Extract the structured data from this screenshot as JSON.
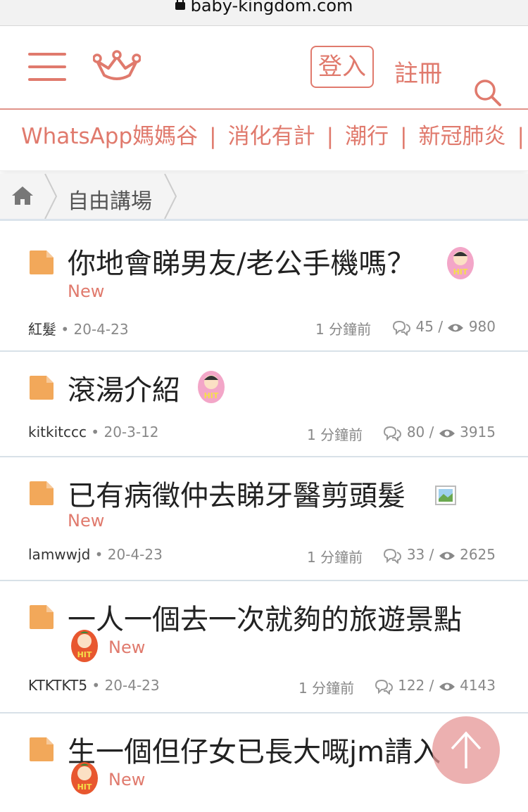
{
  "browser": {
    "url": "baby-kingdom.com"
  },
  "header": {
    "login_label": "登入",
    "register_label": "註冊"
  },
  "categories": [
    "WhatsApp媽媽谷",
    "消化有計",
    "潮行",
    "新冠肺炎"
  ],
  "breadcrumb": {
    "label": "自由講場"
  },
  "threads": [
    {
      "title": "你地會睇男友/老公手機嗎？",
      "new_label": "New",
      "author": "紅髮",
      "date": "20-4-23",
      "time_ago": "1 分鐘前",
      "replies": "45",
      "views": "980"
    },
    {
      "title": "滾湯介紹",
      "new_label": "",
      "author": "kitkitccc",
      "date": "20-3-12",
      "time_ago": "1 分鐘前",
      "replies": "80",
      "views": "3915"
    },
    {
      "title": "已有病徵仲去睇牙醫剪頭髮",
      "new_label": "New",
      "author": "lamwwjd",
      "date": "20-4-23",
      "time_ago": "1 分鐘前",
      "replies": "33",
      "views": "2625"
    },
    {
      "title": "一人一個去一次就夠的旅遊景點",
      "new_label": "New",
      "author": "KTKTKT5",
      "date": "20-4-23",
      "time_ago": "1 分鐘前",
      "replies": "122",
      "views": "4143"
    },
    {
      "title": "生一個但仔女已長大嘅jm請入",
      "new_label": "New"
    }
  ],
  "badges": {
    "hot_text": "HIT"
  },
  "colors": {
    "accent": "#e07a6d",
    "folder": "#f2a85a",
    "divider": "#d8e1e8"
  }
}
